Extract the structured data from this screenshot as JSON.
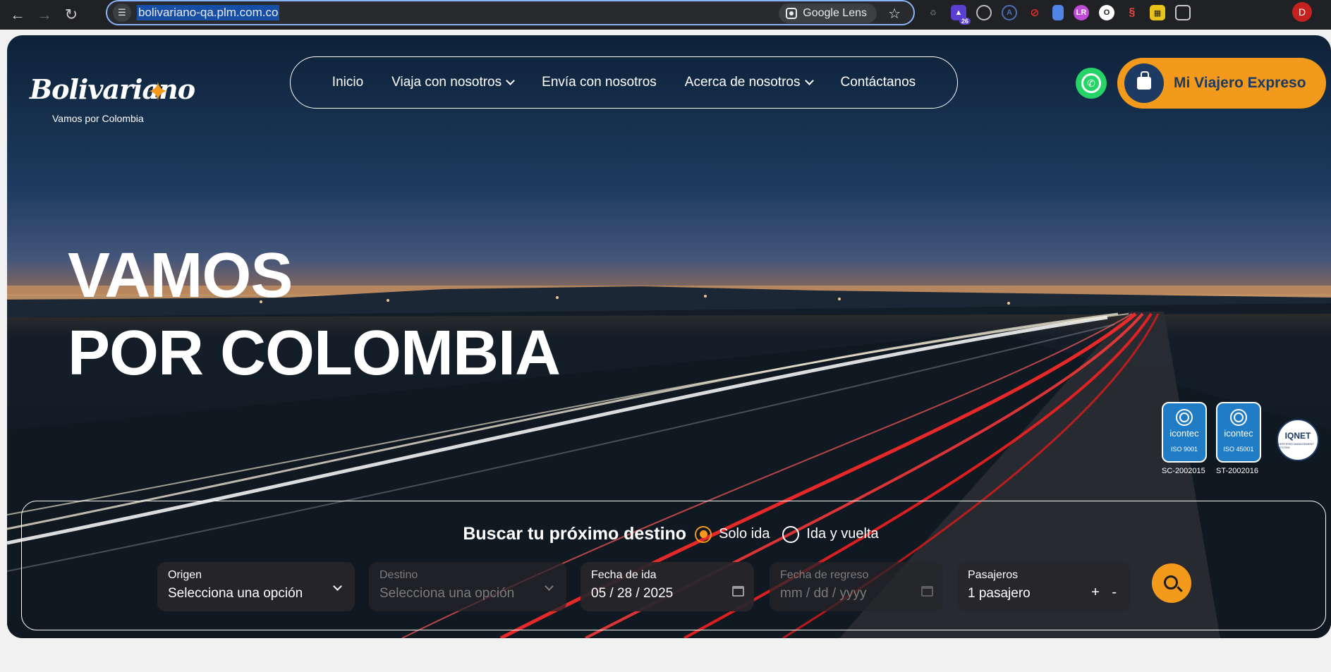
{
  "browser": {
    "url": "bolivariano-qa.plm.com.co",
    "lens_label": "Google Lens",
    "extension_badge": "26",
    "profile_initial": "D",
    "icons": [
      "back-icon",
      "forward-icon",
      "reload-icon",
      "site-settings-icon",
      "google-lens-icon",
      "bookmark-star-icon",
      "extensions-icon"
    ]
  },
  "header": {
    "logo_text": "Bolivariano",
    "logo_tagline": "Vamos por Colombia",
    "nav": [
      {
        "label": "Inicio",
        "dropdown": false
      },
      {
        "label": "Viaja con nosotros",
        "dropdown": true
      },
      {
        "label": "Envía con nosotros",
        "dropdown": false
      },
      {
        "label": "Acerca de nosotros",
        "dropdown": true
      },
      {
        "label": "Contáctanos",
        "dropdown": false
      }
    ],
    "cta_label": "Mi Viajero Expreso"
  },
  "hero": {
    "line1": "VAMOS",
    "line2": "POR COLOMBIA"
  },
  "certifications": [
    {
      "name": "icontec",
      "standard": "ISO 9001",
      "code": "SC-2002015"
    },
    {
      "name": "icontec",
      "standard": "ISO 45001",
      "code": "ST-2002016"
    },
    {
      "name": "IQNET",
      "sub": "CERTIFIED MANAGEMENT SYSTEM"
    }
  ],
  "search": {
    "title": "Buscar tu próximo destino",
    "trip_types": [
      {
        "label": "Solo ida",
        "selected": true
      },
      {
        "label": "Ida y vuelta",
        "selected": false
      }
    ],
    "fields": {
      "origin": {
        "label": "Origen",
        "value": "Selecciona una opción"
      },
      "destination": {
        "label": "Destino",
        "value": "Selecciona una opción"
      },
      "departure": {
        "label": "Fecha de ida",
        "value": "05 / 28 / 2025"
      },
      "return": {
        "label": "Fecha de regreso",
        "value": "mm / dd / yyyy"
      },
      "passengers": {
        "label": "Pasajeros",
        "value": "1 pasajero",
        "stepper": "+ -"
      }
    }
  },
  "colors": {
    "accent": "#f39a1c",
    "brand_navy": "#1d3a63",
    "whatsapp": "#25d366",
    "omnibox_focus": "#8ab4f8"
  }
}
